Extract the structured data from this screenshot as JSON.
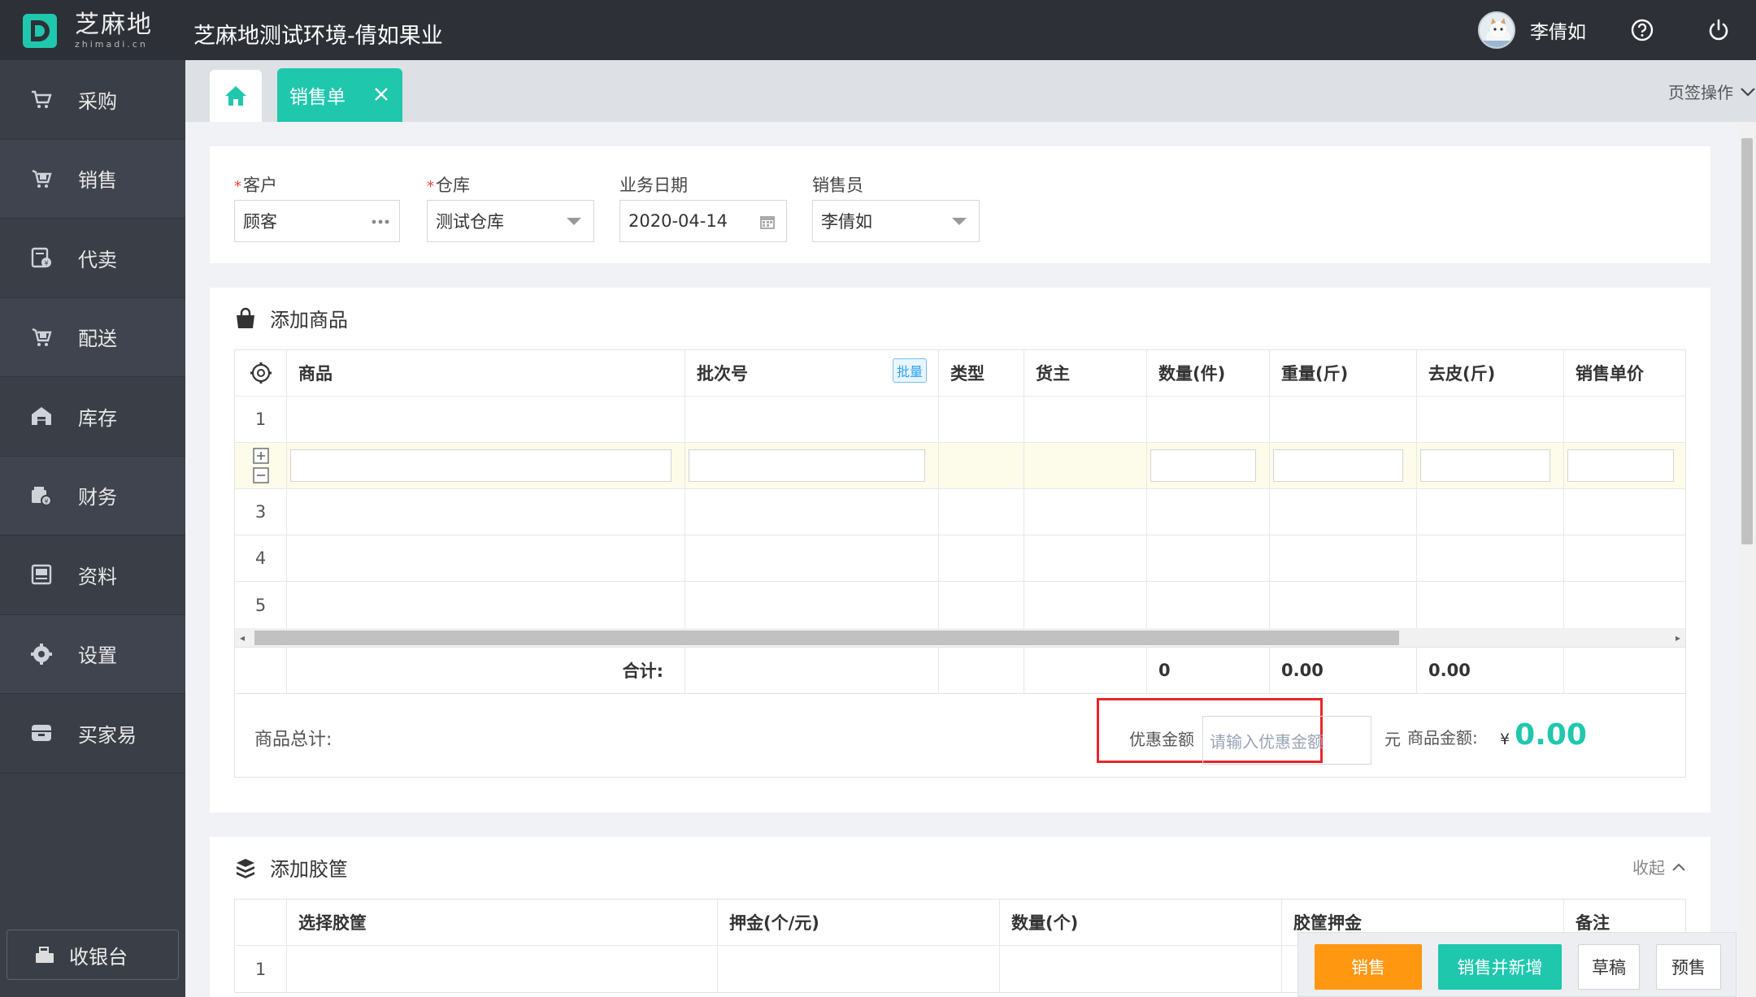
{
  "header": {
    "logo_cn": "芝麻地",
    "logo_en": "zhimadi.cn",
    "app_title": "芝麻地测试环境-倩如果业",
    "user_name": "李倩如"
  },
  "sidebar": {
    "items": [
      {
        "label": "采购",
        "icon": "cart-icon"
      },
      {
        "label": "销售",
        "icon": "sales-cart-icon"
      },
      {
        "label": "代卖",
        "icon": "consign-icon"
      },
      {
        "label": "配送",
        "icon": "delivery-icon"
      },
      {
        "label": "库存",
        "icon": "warehouse-icon"
      },
      {
        "label": "财务",
        "icon": "finance-icon"
      },
      {
        "label": "资料",
        "icon": "profile-icon"
      },
      {
        "label": "设置",
        "icon": "gear-icon"
      },
      {
        "label": "买家易",
        "icon": "store-icon"
      }
    ],
    "cashier_label": "收银台"
  },
  "tabs": {
    "active_label": "销售单",
    "ops_label": "页签操作"
  },
  "form": {
    "customer_label": "客户",
    "customer_value": "顾客",
    "warehouse_label": "仓库",
    "warehouse_value": "测试仓库",
    "date_label": "业务日期",
    "date_value": "2020-04-14",
    "salesperson_label": "销售员",
    "salesperson_value": "李倩如",
    "required_mark": "*"
  },
  "goods": {
    "title": "添加商品",
    "columns": [
      "商品",
      "批次号",
      "类型",
      "货主",
      "数量(件)",
      "重量(斤)",
      "去皮(斤)",
      "销售单价"
    ],
    "batch_badge": "批量",
    "rows": [
      "1",
      "",
      "3",
      "4",
      "5"
    ],
    "sum_label": "合计:",
    "sum_qty": "0",
    "sum_weight": "0.00",
    "sum_tare": "0.00",
    "total_label": "商品总计:",
    "discount_label": "优惠金额",
    "discount_placeholder": "请输入优惠金额",
    "yuan": "元",
    "amount_label": "商品金额:",
    "currency": "¥",
    "amount_value": "0.00"
  },
  "crates": {
    "title": "添加胶筐",
    "collapse_label": "收起",
    "columns": [
      "选择胶筐",
      "押金(个/元)",
      "数量(个)",
      "胶筐押金",
      "备注"
    ],
    "rows": [
      "1"
    ]
  },
  "actions": {
    "sell": "销售",
    "sell_new": "销售并新增",
    "draft": "草稿",
    "presale": "预售"
  },
  "colors": {
    "accent": "#1fc7ad",
    "sidebar": "#3a3e47",
    "topbar": "#2d3037",
    "orange": "#ff9711",
    "highlight": "#e8262b"
  }
}
